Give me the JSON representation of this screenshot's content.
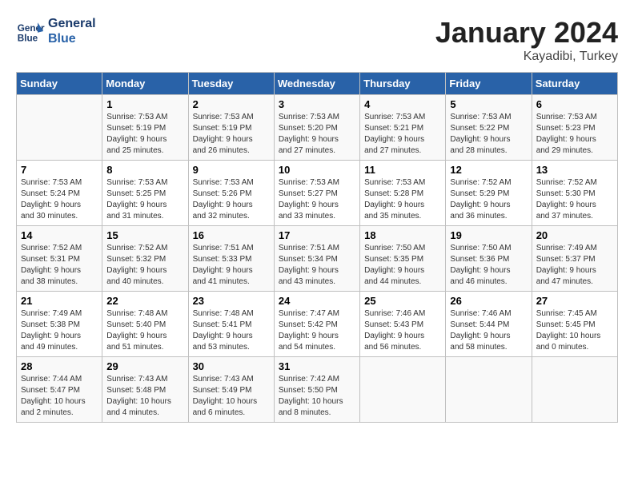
{
  "header": {
    "logo_line1": "General",
    "logo_line2": "Blue",
    "month": "January 2024",
    "location": "Kayadibi, Turkey"
  },
  "weekdays": [
    "Sunday",
    "Monday",
    "Tuesday",
    "Wednesday",
    "Thursday",
    "Friday",
    "Saturday"
  ],
  "weeks": [
    [
      {
        "day": "",
        "info": ""
      },
      {
        "day": "1",
        "info": "Sunrise: 7:53 AM\nSunset: 5:19 PM\nDaylight: 9 hours\nand 25 minutes."
      },
      {
        "day": "2",
        "info": "Sunrise: 7:53 AM\nSunset: 5:19 PM\nDaylight: 9 hours\nand 26 minutes."
      },
      {
        "day": "3",
        "info": "Sunrise: 7:53 AM\nSunset: 5:20 PM\nDaylight: 9 hours\nand 27 minutes."
      },
      {
        "day": "4",
        "info": "Sunrise: 7:53 AM\nSunset: 5:21 PM\nDaylight: 9 hours\nand 27 minutes."
      },
      {
        "day": "5",
        "info": "Sunrise: 7:53 AM\nSunset: 5:22 PM\nDaylight: 9 hours\nand 28 minutes."
      },
      {
        "day": "6",
        "info": "Sunrise: 7:53 AM\nSunset: 5:23 PM\nDaylight: 9 hours\nand 29 minutes."
      }
    ],
    [
      {
        "day": "7",
        "info": "Sunrise: 7:53 AM\nSunset: 5:24 PM\nDaylight: 9 hours\nand 30 minutes."
      },
      {
        "day": "8",
        "info": "Sunrise: 7:53 AM\nSunset: 5:25 PM\nDaylight: 9 hours\nand 31 minutes."
      },
      {
        "day": "9",
        "info": "Sunrise: 7:53 AM\nSunset: 5:26 PM\nDaylight: 9 hours\nand 32 minutes."
      },
      {
        "day": "10",
        "info": "Sunrise: 7:53 AM\nSunset: 5:27 PM\nDaylight: 9 hours\nand 33 minutes."
      },
      {
        "day": "11",
        "info": "Sunrise: 7:53 AM\nSunset: 5:28 PM\nDaylight: 9 hours\nand 35 minutes."
      },
      {
        "day": "12",
        "info": "Sunrise: 7:52 AM\nSunset: 5:29 PM\nDaylight: 9 hours\nand 36 minutes."
      },
      {
        "day": "13",
        "info": "Sunrise: 7:52 AM\nSunset: 5:30 PM\nDaylight: 9 hours\nand 37 minutes."
      }
    ],
    [
      {
        "day": "14",
        "info": "Sunrise: 7:52 AM\nSunset: 5:31 PM\nDaylight: 9 hours\nand 38 minutes."
      },
      {
        "day": "15",
        "info": "Sunrise: 7:52 AM\nSunset: 5:32 PM\nDaylight: 9 hours\nand 40 minutes."
      },
      {
        "day": "16",
        "info": "Sunrise: 7:51 AM\nSunset: 5:33 PM\nDaylight: 9 hours\nand 41 minutes."
      },
      {
        "day": "17",
        "info": "Sunrise: 7:51 AM\nSunset: 5:34 PM\nDaylight: 9 hours\nand 43 minutes."
      },
      {
        "day": "18",
        "info": "Sunrise: 7:50 AM\nSunset: 5:35 PM\nDaylight: 9 hours\nand 44 minutes."
      },
      {
        "day": "19",
        "info": "Sunrise: 7:50 AM\nSunset: 5:36 PM\nDaylight: 9 hours\nand 46 minutes."
      },
      {
        "day": "20",
        "info": "Sunrise: 7:49 AM\nSunset: 5:37 PM\nDaylight: 9 hours\nand 47 minutes."
      }
    ],
    [
      {
        "day": "21",
        "info": "Sunrise: 7:49 AM\nSunset: 5:38 PM\nDaylight: 9 hours\nand 49 minutes."
      },
      {
        "day": "22",
        "info": "Sunrise: 7:48 AM\nSunset: 5:40 PM\nDaylight: 9 hours\nand 51 minutes."
      },
      {
        "day": "23",
        "info": "Sunrise: 7:48 AM\nSunset: 5:41 PM\nDaylight: 9 hours\nand 53 minutes."
      },
      {
        "day": "24",
        "info": "Sunrise: 7:47 AM\nSunset: 5:42 PM\nDaylight: 9 hours\nand 54 minutes."
      },
      {
        "day": "25",
        "info": "Sunrise: 7:46 AM\nSunset: 5:43 PM\nDaylight: 9 hours\nand 56 minutes."
      },
      {
        "day": "26",
        "info": "Sunrise: 7:46 AM\nSunset: 5:44 PM\nDaylight: 9 hours\nand 58 minutes."
      },
      {
        "day": "27",
        "info": "Sunrise: 7:45 AM\nSunset: 5:45 PM\nDaylight: 10 hours\nand 0 minutes."
      }
    ],
    [
      {
        "day": "28",
        "info": "Sunrise: 7:44 AM\nSunset: 5:47 PM\nDaylight: 10 hours\nand 2 minutes."
      },
      {
        "day": "29",
        "info": "Sunrise: 7:43 AM\nSunset: 5:48 PM\nDaylight: 10 hours\nand 4 minutes."
      },
      {
        "day": "30",
        "info": "Sunrise: 7:43 AM\nSunset: 5:49 PM\nDaylight: 10 hours\nand 6 minutes."
      },
      {
        "day": "31",
        "info": "Sunrise: 7:42 AM\nSunset: 5:50 PM\nDaylight: 10 hours\nand 8 minutes."
      },
      {
        "day": "",
        "info": ""
      },
      {
        "day": "",
        "info": ""
      },
      {
        "day": "",
        "info": ""
      }
    ]
  ]
}
